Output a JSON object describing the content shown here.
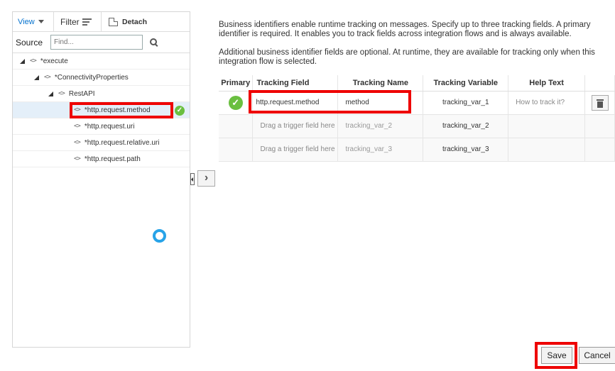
{
  "toolbar": {
    "view_label": "View",
    "filter_label": "Filter",
    "detach_label": "Detach"
  },
  "source": {
    "label": "Source",
    "placeholder": "Find..."
  },
  "tree": [
    {
      "label": "*execute",
      "indent": 0,
      "expanded": true
    },
    {
      "label": "*ConnectivityProperties",
      "indent": 1,
      "expanded": true
    },
    {
      "label": "RestAPI",
      "indent": 2,
      "expanded": true
    },
    {
      "label": "*http.request.method",
      "indent": 3,
      "selected": true,
      "mapped": true
    },
    {
      "label": "*http.request.uri",
      "indent": 3
    },
    {
      "label": "*http.request.relative.uri",
      "indent": 3
    },
    {
      "label": "*http.request.path",
      "indent": 3
    }
  ],
  "description": {
    "para1": "Business identifiers enable runtime tracking on messages. Specify up to three tracking fields. A primary identifier is required. It enables you to track fields across integration flows and is always available.",
    "para2": "Additional business identifier fields are optional. At runtime, they are available for tracking only when this integration flow is selected."
  },
  "grid": {
    "headers": [
      "Primary",
      "Tracking Field",
      "Tracking Name",
      "Tracking Variable",
      "Help Text",
      ""
    ],
    "rows": [
      {
        "primary": true,
        "field": "http.request.method",
        "name": "method",
        "variable": "tracking_var_1",
        "help": "How to track it?"
      },
      {
        "primary": false,
        "field": "Drag a trigger field here",
        "name": "tracking_var_2",
        "variable": "tracking_var_2",
        "help": ""
      },
      {
        "primary": false,
        "field": "Drag a trigger field here",
        "name": "tracking_var_3",
        "variable": "tracking_var_3",
        "help": ""
      }
    ]
  },
  "buttons": {
    "save": "Save",
    "cancel": "Cancel"
  },
  "colors": {
    "highlight_red": "#e00000",
    "check_green": "#6abf40",
    "link_blue": "#0572ce",
    "spinner_blue": "#27a3e8"
  }
}
